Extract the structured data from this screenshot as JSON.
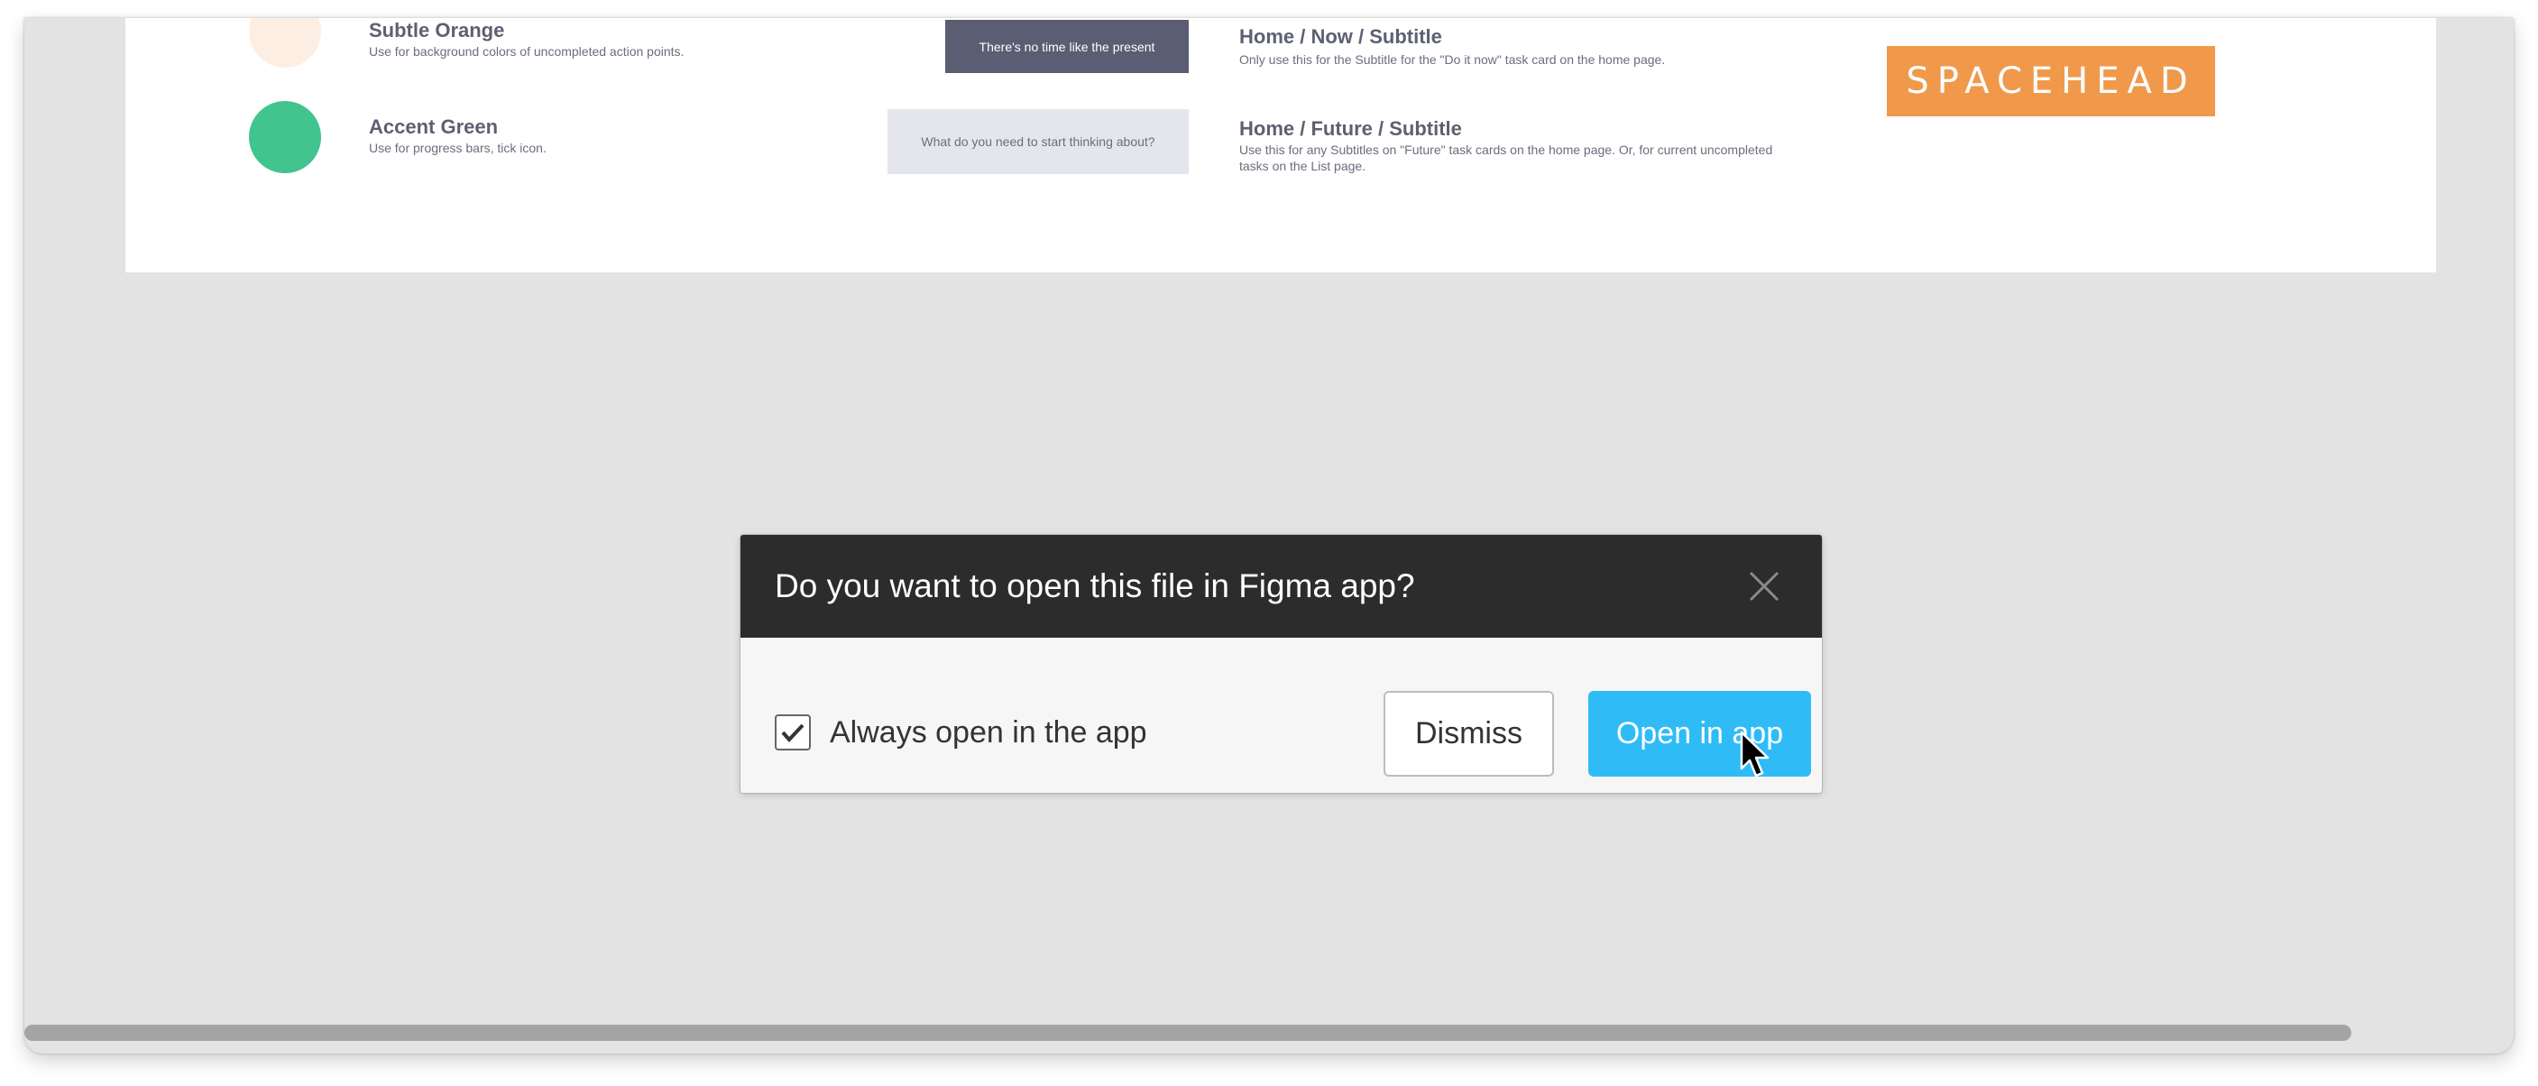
{
  "colors": {
    "subtle_orange": "#fdeee4",
    "accent_green": "#41c48e",
    "dark_sample_bg": "#5b5d72",
    "light_sample_bg": "#e5e6ec",
    "brand_orange": "#f0994b",
    "dialog_header": "#2c2c2c",
    "primary_button": "#2fbcf6",
    "canvas_gray": "#e3e3e3"
  },
  "style_guide": {
    "swatches": [
      {
        "name": "Subtle Orange",
        "description": "Use for background colors of uncompleted action points."
      },
      {
        "name": "Accent Green",
        "description": "Use for progress bars, tick icon."
      }
    ],
    "samples": [
      {
        "text": "There's no time like the present"
      },
      {
        "text": "What do you need to start thinking about?"
      }
    ],
    "type_styles": [
      {
        "name": "Home / Now / Subtitle",
        "description": "Only use this for the Subtitle for the \"Do it now\" task card on the home page."
      },
      {
        "name": "Home / Future / Subtitle",
        "description": "Use this for any Subtitles on \"Future\" task cards on the home page. Or, for current uncompleted tasks on the List page."
      }
    ],
    "logo_text": "SPACEHEAD"
  },
  "dialog": {
    "title": "Do you want to open this file in Figma app?",
    "close_icon": "close-icon",
    "checkbox_label": "Always open in the app",
    "checkbox_checked": true,
    "dismiss_label": "Dismiss",
    "open_label": "Open in app"
  },
  "icons": {
    "close": "close-icon",
    "check": "checkmark-icon",
    "cursor": "mouse-pointer-icon"
  }
}
